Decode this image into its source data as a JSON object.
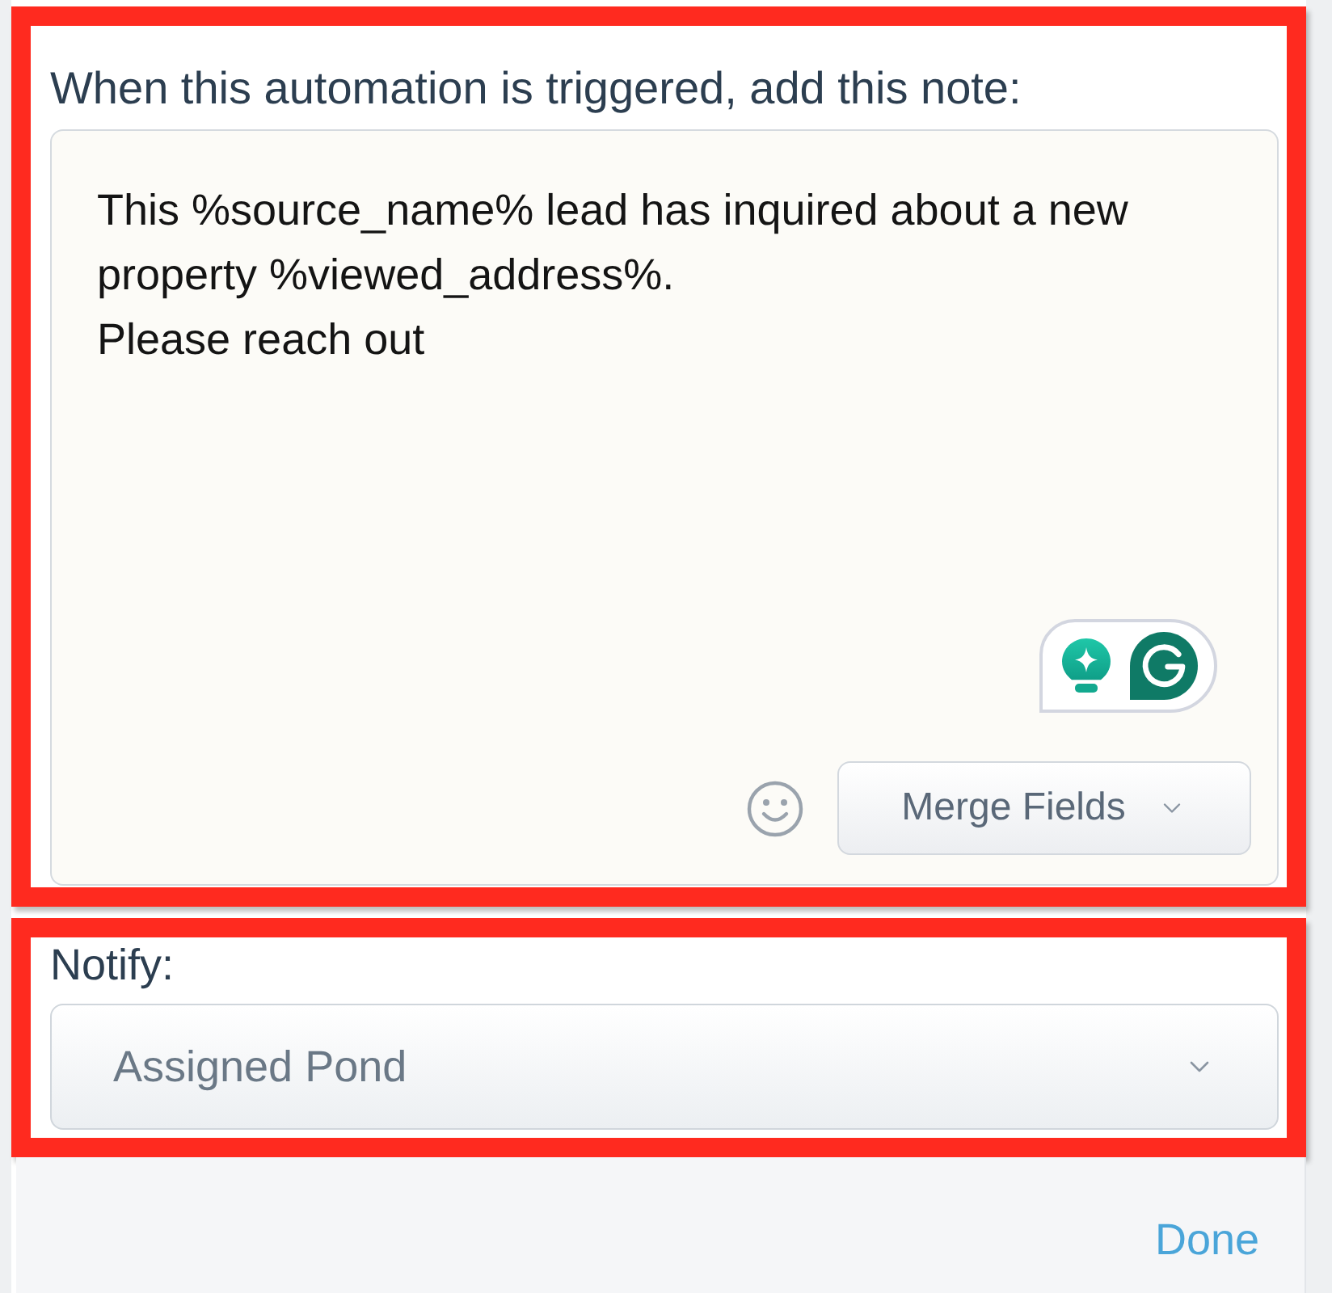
{
  "note_section": {
    "label": "When this automation is triggered, add this note:",
    "note": {
      "value": "This %source_name% lead has inquired about a new\nproperty %viewed_address%.\nPlease reach out"
    },
    "merge_fields_button": {
      "label": "Merge Fields"
    }
  },
  "notify": {
    "label": "Notify:",
    "select": {
      "value": "Assigned Pond"
    }
  },
  "footer": {
    "done_button": {
      "label": "Done"
    }
  }
}
